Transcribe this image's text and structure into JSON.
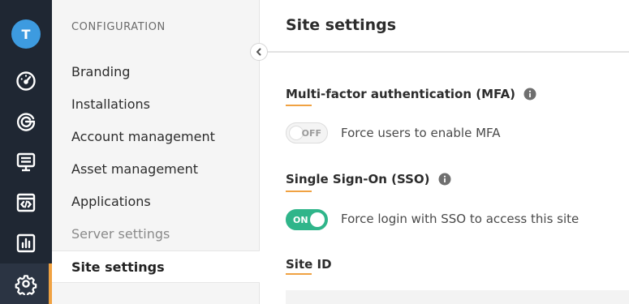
{
  "rail": {
    "avatar_initial": "T",
    "items": [
      {
        "icon": "speedometer-icon"
      },
      {
        "icon": "analytics-ring-icon"
      },
      {
        "icon": "monitor-list-icon"
      },
      {
        "icon": "code-window-icon"
      },
      {
        "icon": "bar-chart-icon"
      },
      {
        "icon": "gear-icon",
        "active": true
      }
    ],
    "accent": "#f0a242"
  },
  "config": {
    "heading": "CONFIGURATION",
    "items": [
      {
        "label": "Branding"
      },
      {
        "label": "Installations"
      },
      {
        "label": "Account management"
      },
      {
        "label": "Asset management"
      },
      {
        "label": "Applications"
      },
      {
        "label": "Server settings"
      },
      {
        "label": "Site settings"
      }
    ]
  },
  "main": {
    "title": "Site settings",
    "mfa": {
      "title": "Multi-factor authentication (MFA)",
      "toggle_state": "OFF",
      "label": "Force users to enable MFA"
    },
    "sso": {
      "title": "Single Sign-On (SSO)",
      "toggle_state": "ON",
      "label": "Force login with SSO to access this site"
    },
    "site_id": {
      "title": "Site ID"
    }
  },
  "colors": {
    "rail_bg": "#1f2733",
    "avatar": "#3d9be0",
    "toggle_on": "#2fb58a"
  }
}
